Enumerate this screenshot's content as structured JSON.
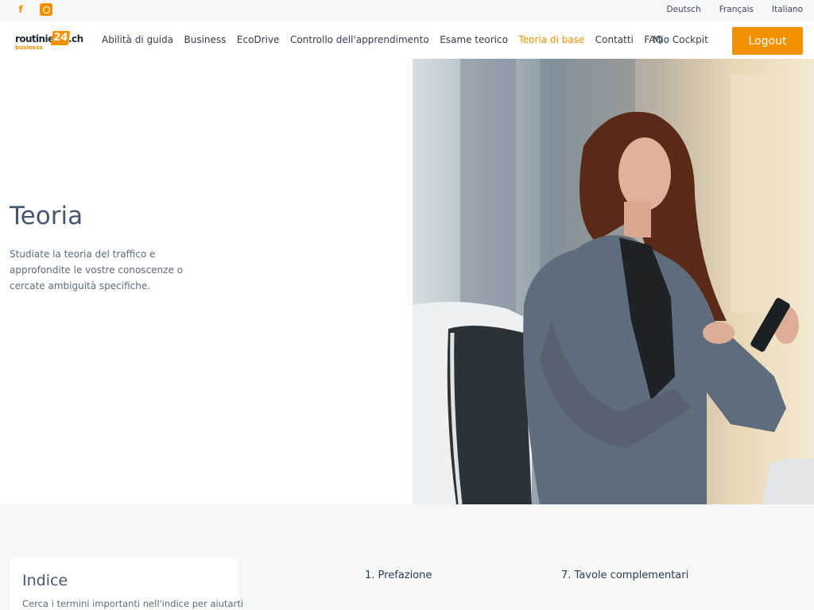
{
  "topbar": {
    "social": [
      "facebook-icon",
      "instagram-icon"
    ],
    "languages": [
      "Deutsch",
      "Français",
      "Italiano"
    ]
  },
  "brand": {
    "word": "routinier",
    "number": "24",
    "tld": ".ch",
    "sub": "business"
  },
  "nav": {
    "items": [
      "Abilità di guida",
      "Business",
      "EcoDrive",
      "Controllo dell'apprendimento",
      "Esame teorico",
      "Teoria di base",
      "Contatti",
      "FAQ"
    ],
    "active_index": 5,
    "cockpit": "Mio Cockpit",
    "logout": "Logout"
  },
  "hero": {
    "title": "Teoria",
    "text": "Studiate la teoria del traffico e approfondite le vostre conoscenze o cercate ambiguità specifiche."
  },
  "index_card": {
    "title": "Indice",
    "text": "Cerca i termini importanti nell'indice per aiutarti"
  },
  "toc": {
    "left": [
      "1. Prefazione"
    ],
    "right": [
      "7. Tavole complementari"
    ]
  },
  "colors": {
    "accent": "#f39200",
    "heading": "#45576e",
    "text": "#5c6b7d",
    "light_bg": "#f6f7f9"
  }
}
